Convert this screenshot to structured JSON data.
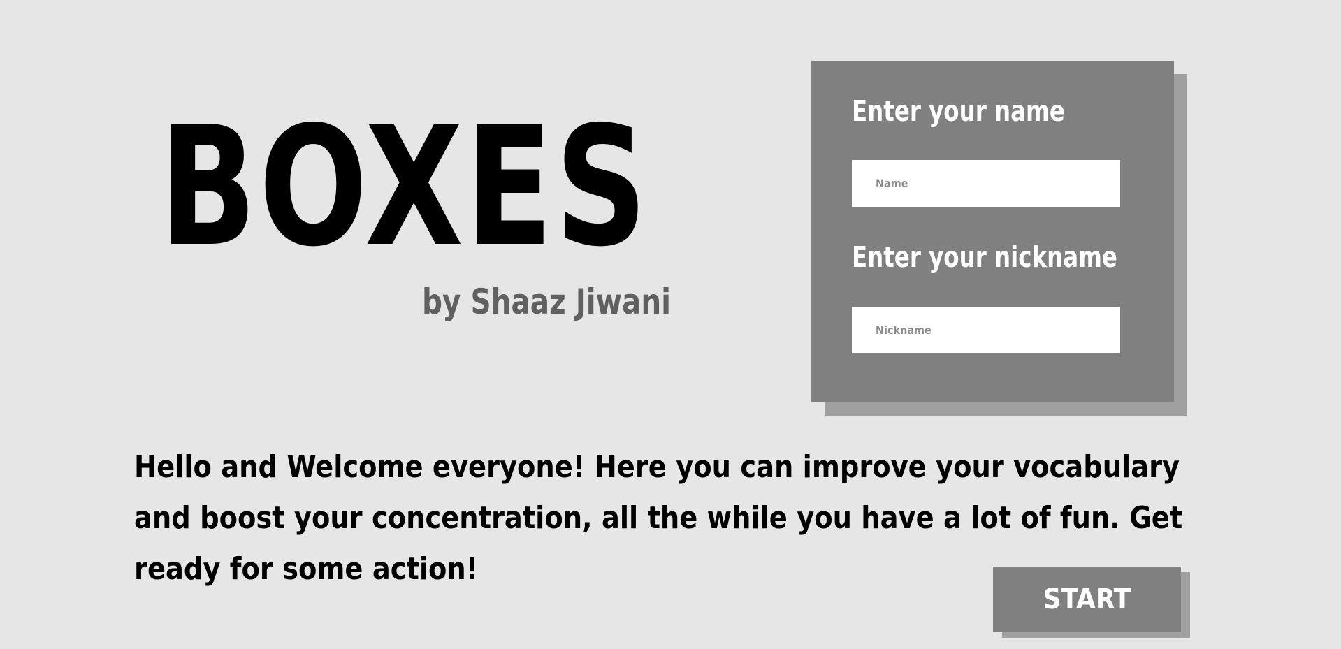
{
  "header": {
    "title": "BOXES",
    "byline": "by Shaaz Jiwani"
  },
  "form": {
    "name_heading": "Enter your name",
    "name_placeholder": "Name",
    "name_value": "",
    "nickname_heading": "Enter your nickname",
    "nickname_placeholder": "Nickname",
    "nickname_value": ""
  },
  "main": {
    "welcome_text": "Hello and Welcome everyone! Here you can improve your vocabulary and boost your concentration, all the while you have a lot of fun. Get ready for some action!"
  },
  "actions": {
    "start_label": "START"
  },
  "colors": {
    "background": "#e6e6e6",
    "card": "#808080",
    "card_shadow": "#a0a0a0",
    "byline": "#606060",
    "text": "#000000"
  }
}
